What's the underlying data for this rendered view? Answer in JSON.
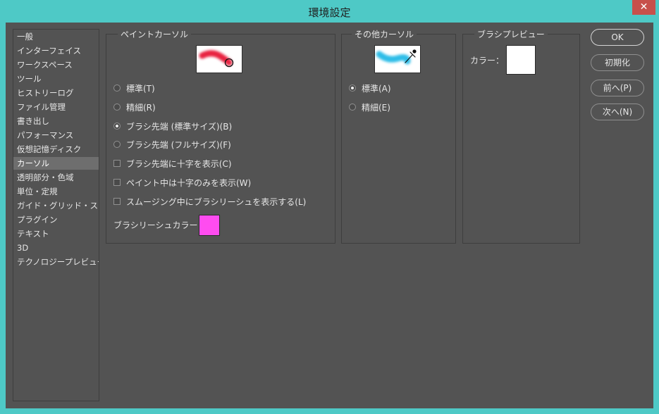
{
  "window": {
    "title": "環境設定",
    "close_glyph": "✕"
  },
  "nav": {
    "items": [
      {
        "label": "一般"
      },
      {
        "label": "インターフェイス"
      },
      {
        "label": "ワークスペース"
      },
      {
        "label": "ツール"
      },
      {
        "label": "ヒストリーログ"
      },
      {
        "label": "ファイル管理"
      },
      {
        "label": "書き出し"
      },
      {
        "label": "パフォーマンス"
      },
      {
        "label": "仮想記憶ディスク"
      },
      {
        "label": "カーソル",
        "selected": true
      },
      {
        "label": "透明部分・色域"
      },
      {
        "label": "単位・定規"
      },
      {
        "label": "ガイド・グリッド・スライス"
      },
      {
        "label": "プラグイン"
      },
      {
        "label": "テキスト"
      },
      {
        "label": "3D"
      },
      {
        "label": "テクノロジープレビュー"
      }
    ]
  },
  "paint_cursor": {
    "legend": "ペイントカーソル",
    "preview_color": "#e8203f",
    "options": [
      {
        "label": "標準(T)",
        "selected": false
      },
      {
        "label": "精細(R)",
        "selected": false
      },
      {
        "label": "ブラシ先端 (標準サイズ)(B)",
        "selected": true
      },
      {
        "label": "ブラシ先端 (フルサイズ)(F)",
        "selected": false
      }
    ],
    "checkboxes": [
      {
        "label": "ブラシ先端に十字を表示(C)",
        "checked": false
      },
      {
        "label": "ペイント中は十字のみを表示(W)",
        "checked": false
      },
      {
        "label": "スムージング中にブラシリーシュを表示する(L)",
        "checked": false
      }
    ],
    "leash_color_label": "ブラシリーシュカラー：",
    "leash_color": "#ff4cf0"
  },
  "other_cursor": {
    "legend": "その他カーソル",
    "preview_color": "#2fbde8",
    "options": [
      {
        "label": "標準(A)",
        "selected": true
      },
      {
        "label": "精細(E)",
        "selected": false
      }
    ]
  },
  "brush_preview": {
    "legend": "ブラシプレビュー",
    "color_label": "カラー：",
    "color": "#ffffff"
  },
  "buttons": {
    "ok": "OK",
    "reset": "初期化",
    "prev": "前へ(P)",
    "next": "次へ(N)"
  }
}
